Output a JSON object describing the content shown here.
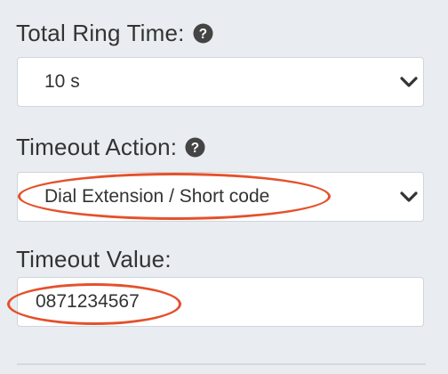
{
  "ring_time": {
    "label": "Total Ring Time:",
    "selected": "10 s",
    "help_icon": "question-circle-icon",
    "chevron_icon": "chevron-down-icon"
  },
  "timeout_action": {
    "label": "Timeout Action:",
    "selected": "Dial Extension / Short code",
    "help_icon": "question-circle-icon",
    "chevron_icon": "chevron-down-icon"
  },
  "timeout_value": {
    "label": "Timeout Value:",
    "value": "0871234567"
  },
  "colors": {
    "background": "#e9edf1",
    "text": "#333333",
    "annotation": "#e4512b",
    "border": "#cfd5db"
  }
}
